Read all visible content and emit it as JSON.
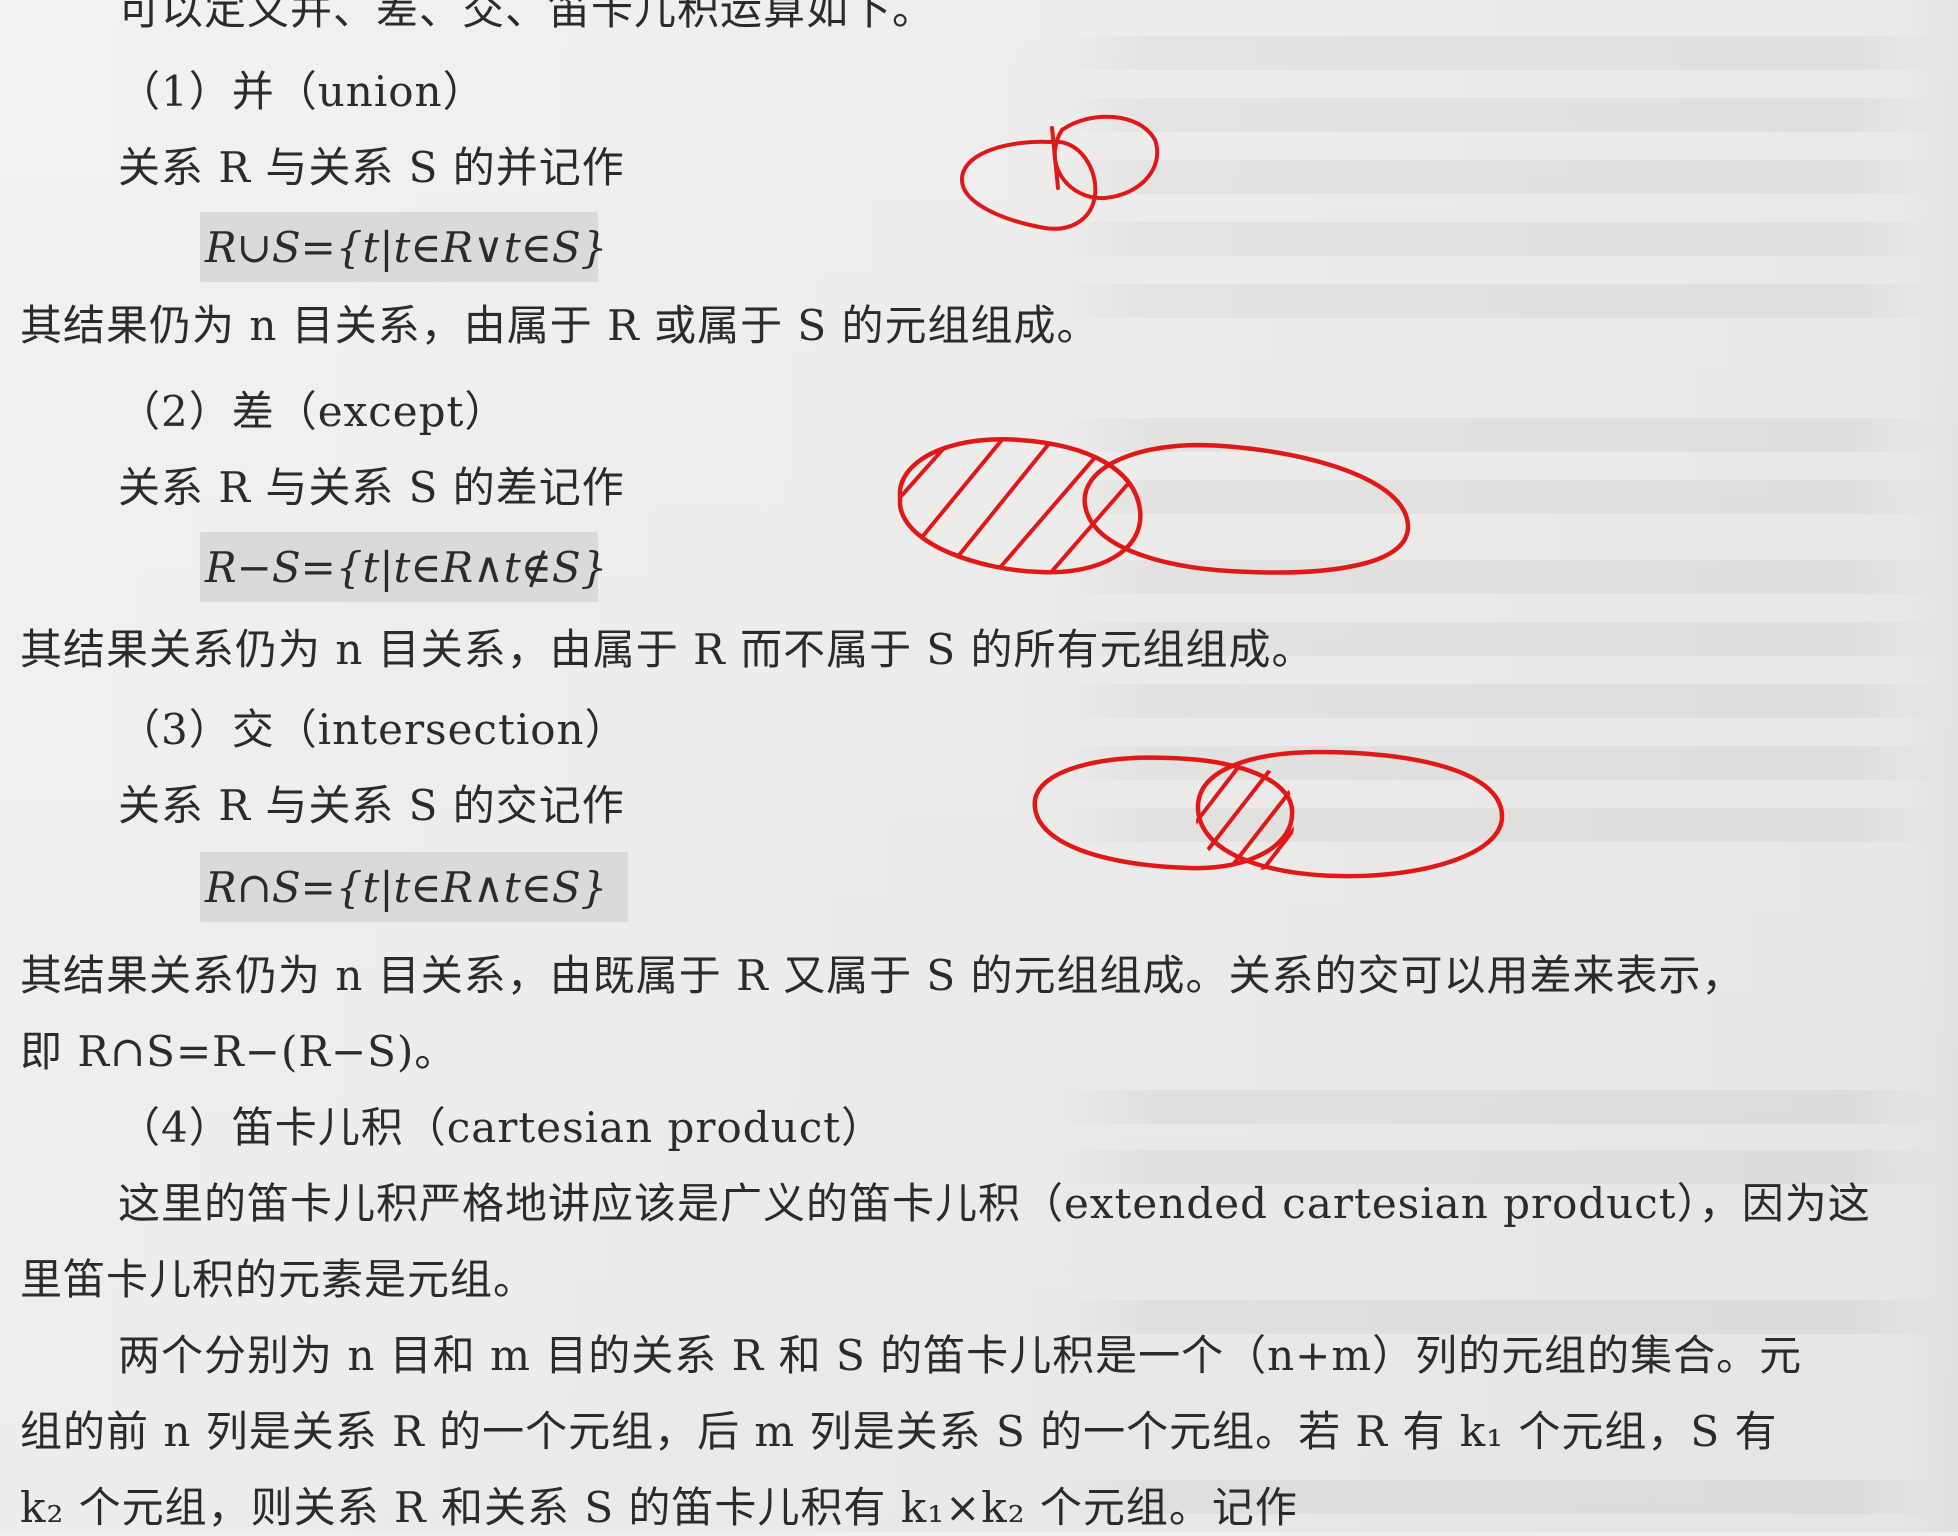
{
  "lines": {
    "intro": "可以定义并、差、交、笛卡儿积运算如下。",
    "union_title": "（1）并（union）",
    "union_desc": "关系 R 与关系 S 的并记作",
    "union_formula": "R∪S={t|t∈R∨t∈S}",
    "union_result": "其结果仍为 n 目关系，由属于 R 或属于 S 的元组组成。",
    "except_title": "（2）差（except）",
    "except_desc": "关系 R 与关系 S 的差记作",
    "except_formula": "R−S={t|t∈R∧t∉S}",
    "except_result": "其结果关系仍为 n 目关系，由属于 R 而不属于 S 的所有元组组成。",
    "intersect_title": "（3）交（intersection）",
    "intersect_desc": "关系 R 与关系 S 的交记作",
    "intersect_formula": "R∩S={t|t∈R∧t∈S}",
    "intersect_result": "其结果关系仍为 n 目关系，由既属于 R 又属于 S 的元组组成。关系的交可以用差来表示，",
    "intersect_result2": "即 R∩S=R−(R−S)。",
    "cartesian_title": "（4）笛卡儿积（cartesian product）",
    "cartesian_p1_a": "这里的笛卡儿积严格地讲应该是广义的笛卡儿积（extended cartesian product），因为这",
    "cartesian_p1_b": "里笛卡儿积的元素是元组。",
    "cartesian_p2_a": "两个分别为 n 目和 m 目的关系 R 和 S 的笛卡儿积是一个（n+m）列的元组的集合。元",
    "cartesian_p2_b": "组的前 n 列是关系 R 的一个元组，后 m 列是关系 S 的一个元组。若 R 有 k₁ 个元组，S 有",
    "cartesian_p2_c": "k₂ 个元组，则关系 R 和关系 S 的笛卡儿积有 k₁×k₂ 个元组。记作"
  },
  "annotations": {
    "ink_color": "#e01818",
    "union_sketch": "two-small-circles",
    "except_sketch": "left-ellipse-hatched",
    "intersect_sketch": "overlap-hatched"
  }
}
